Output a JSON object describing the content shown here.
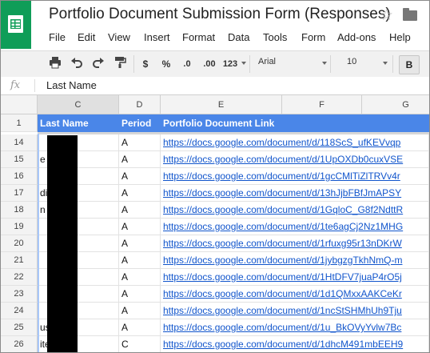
{
  "title": "Portfolio Document Submission Form (Responses)",
  "icons": {
    "star": "star-icon",
    "folder": "folder-icon",
    "logo": "sheets-logo-icon"
  },
  "menu": [
    "File",
    "Edit",
    "View",
    "Insert",
    "Format",
    "Data",
    "Tools",
    "Form",
    "Add-ons",
    "Help"
  ],
  "toolbar": {
    "currency": "$",
    "percent": "%",
    "decrease_decimal": ".0",
    "increase_decimal": ".00",
    "more_formats": "123",
    "font": "Arial",
    "font_size": "10",
    "bold": "B"
  },
  "formula_bar": {
    "fx": "fx",
    "value": "Last Name"
  },
  "columns": [
    "C",
    "D",
    "E",
    "F",
    "G"
  ],
  "header_row": {
    "number": "1",
    "c": "Last Name",
    "d": "Period",
    "e": "Portfolio Document Link"
  },
  "rows": [
    {
      "number": "14",
      "c": "",
      "d": "A",
      "e": "https://docs.google.com/document/d/118ScS_ufKEVvqp"
    },
    {
      "number": "15",
      "c": "e",
      "d": "A",
      "e": "https://docs.google.com/document/d/1UpOXDb0cuxVSE"
    },
    {
      "number": "16",
      "c": "",
      "d": "A",
      "e": "https://docs.google.com/document/d/1gcCMlTiZlTRVv4r"
    },
    {
      "number": "17",
      "c": "din",
      "d": "A",
      "e": "https://docs.google.com/document/d/13hJjbFBfJmAPSY"
    },
    {
      "number": "18",
      "c": "n",
      "d": "A",
      "e": "https://docs.google.com/document/d/1GqloC_G8f2NdttR"
    },
    {
      "number": "19",
      "c": "",
      "d": "A",
      "e": "https://docs.google.com/document/d/1te6agCj2Nz1MHG"
    },
    {
      "number": "20",
      "c": "",
      "d": "A",
      "e": "https://docs.google.com/document/d/1rfuxg95r13nDKrW"
    },
    {
      "number": "21",
      "c": "",
      "d": "A",
      "e": "https://docs.google.com/document/d/1jybgzgTkhNmQ-m"
    },
    {
      "number": "22",
      "c": "",
      "d": "A",
      "e": "https://docs.google.com/document/d/1HtDFV7juaP4rO5j"
    },
    {
      "number": "23",
      "c": "",
      "d": "A",
      "e": "https://docs.google.com/document/d/1d1QMxxAAKCeKr"
    },
    {
      "number": "24",
      "c": "",
      "d": "A",
      "e": "https://docs.google.com/document/d/1ncStSHMhUh9Tju"
    },
    {
      "number": "25",
      "c": "use",
      "d": "A",
      "e": "https://docs.google.com/document/d/1u_BkOVyYvlw7Bc"
    },
    {
      "number": "26",
      "c": "ite",
      "d": "C",
      "e": "https://docs.google.com/document/d/1dhcM491mbEEH9"
    }
  ]
}
